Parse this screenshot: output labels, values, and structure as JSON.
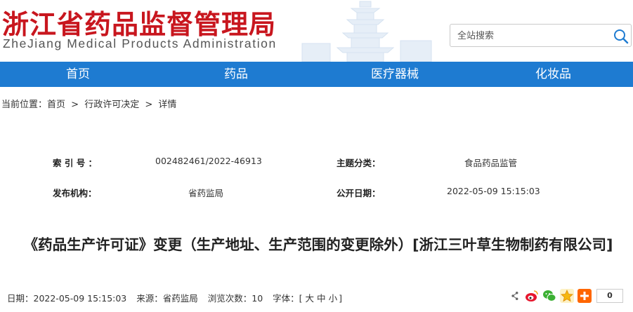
{
  "header": {
    "title": "浙江省药品监督管理局",
    "subtitle": "ZheJiang Medical Products Administration",
    "search_placeholder": "全站搜索"
  },
  "nav": {
    "items": [
      {
        "label": "首页"
      },
      {
        "label": "药品"
      },
      {
        "label": "医疗器械"
      },
      {
        "label": "化妆品"
      }
    ]
  },
  "breadcrumb": {
    "prefix": "当前位置：",
    "items": [
      "首页",
      "行政许可决定",
      "详情"
    ],
    "separator": ">"
  },
  "info": {
    "index_label": "索 引 号 ：",
    "index_value": "002482461/2022-46913",
    "category_label": "主题分类：",
    "category_value": "食品药品监管",
    "publisher_label": "发布机构：",
    "publisher_value": "省药监局",
    "date_label": "公开日期：",
    "date_value": "2022-05-09 15:15:03"
  },
  "article": {
    "title": "《药品生产许可证》变更（生产地址、生产范围的变更除外）[浙江三叶草生物制药有限公司]"
  },
  "meta": {
    "date": "日期：2022-05-09 15:15:03",
    "source": "来源：省药监局",
    "views": "浏览次数：10",
    "font_label": "字体：[",
    "font_large": "大",
    "font_medium": "中",
    "font_small": "小",
    "font_close": "]"
  },
  "share": {
    "count": "0",
    "colors": {
      "weibo": "#e6162d",
      "wechat": "#3cb034",
      "qzone": "#f5b70f",
      "more": "#ff6600"
    }
  },
  "colors": {
    "brand_red": "#c8161e",
    "nav_blue": "#1e7bd1"
  }
}
